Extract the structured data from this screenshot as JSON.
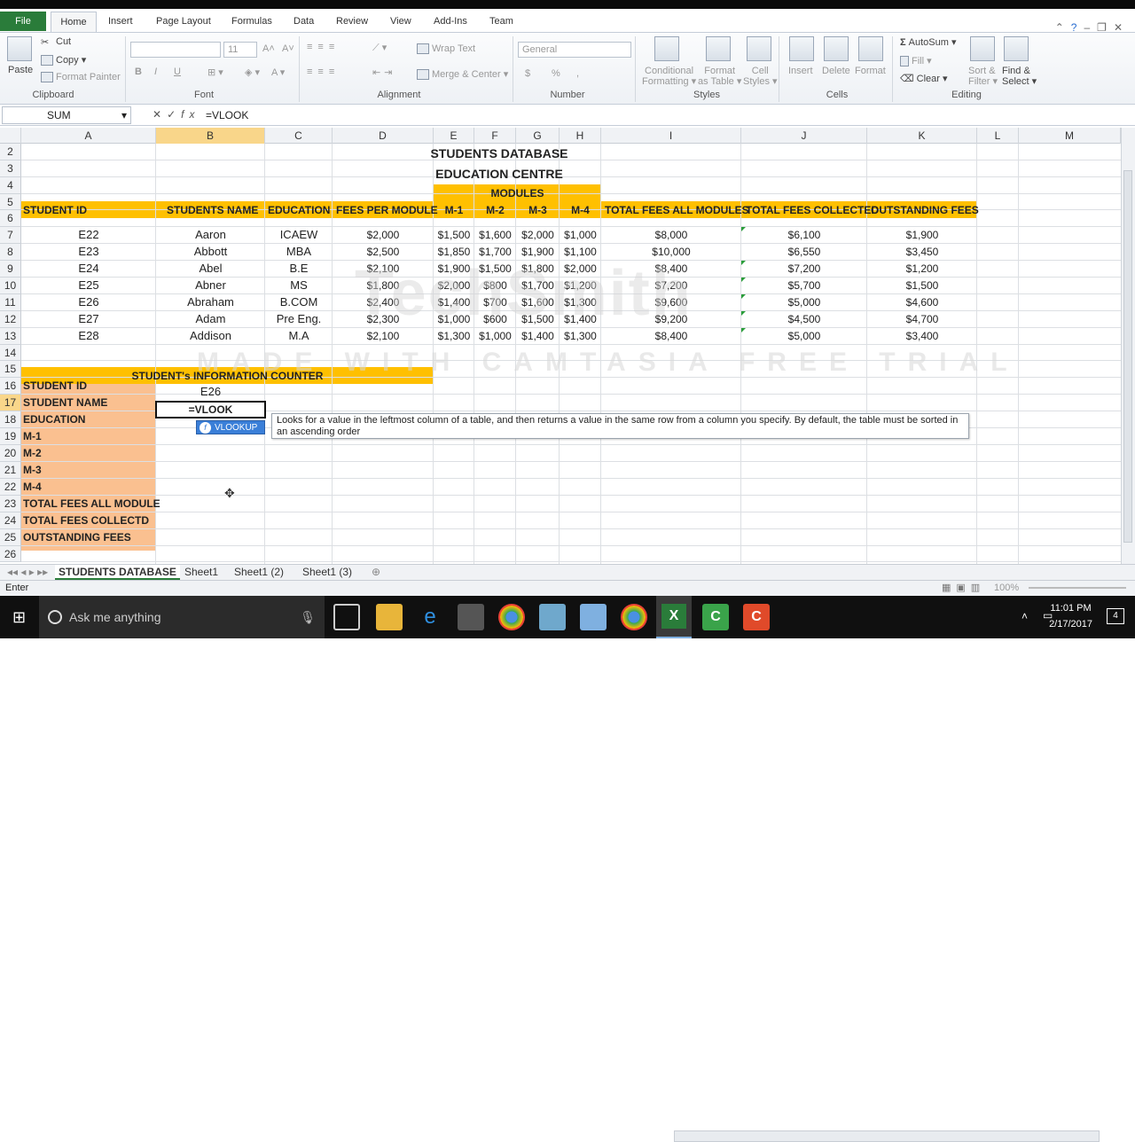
{
  "ribbon_tabs": [
    "File",
    "Home",
    "Insert",
    "Page Layout",
    "Formulas",
    "Data",
    "Review",
    "View",
    "Add-Ins",
    "Team"
  ],
  "clipboard": {
    "paste": "Paste",
    "cut": "Cut",
    "copy": "Copy",
    "format_painter": "Format Painter",
    "label": "Clipboard"
  },
  "font": {
    "name": "",
    "size": "11",
    "label": "Font",
    "bold": "B",
    "italic": "I",
    "underline": "U"
  },
  "alignment": {
    "wrap_text": "Wrap Text",
    "merge_center": "Merge & Center",
    "label": "Alignment"
  },
  "number": {
    "format": "General",
    "label": "Number",
    "currency": "$",
    "percent": "%",
    "comma": ","
  },
  "styles": {
    "conditional": "Conditional",
    "formatting": "Formatting",
    "format": "Format",
    "as_table": "as Table",
    "cell": "Cell",
    "cell_styles": "Styles",
    "label": "Styles"
  },
  "cells": {
    "insert": "Insert",
    "delete": "Delete",
    "format": "Format",
    "label": "Cells"
  },
  "editing": {
    "autosum": "AutoSum",
    "fill": "Fill",
    "clear": "Clear",
    "sort": "Sort &",
    "filter": "Filter",
    "find": "Find &",
    "select": "Select",
    "label": "Editing"
  },
  "formula_bar": {
    "name_box": "SUM",
    "formula": "=VLOOK"
  },
  "columns": [
    "A",
    "B",
    "C",
    "D",
    "E",
    "F",
    "G",
    "H",
    "I",
    "J",
    "K",
    "L",
    "M"
  ],
  "rows": [
    "2",
    "3",
    "4",
    "5",
    "6",
    "7",
    "8",
    "9",
    "10",
    "11",
    "12",
    "13",
    "14",
    "15",
    "16",
    "17",
    "18",
    "19",
    "20",
    "21",
    "22",
    "23",
    "24",
    "25",
    "26"
  ],
  "sheet": {
    "title1": "STUDENTS DATABASE",
    "title2": "EDUCATION CENTRE",
    "modules_label": "MODULES",
    "headers": [
      "STUDENT ID",
      "STUDENTS NAME",
      "EDUCATION",
      "FEES PER MODULE",
      "M-1",
      "M-2",
      "M-3",
      "M-4",
      "TOTAL FEES ALL MODULES",
      "TOTAL FEES COLLECTED",
      "OUTSTANDING FEES"
    ],
    "records": [
      [
        "E22",
        "Aaron",
        "ICAEW",
        "$2,000",
        "$1,500",
        "$1,600",
        "$2,000",
        "$1,000",
        "$8,000",
        "$6,100",
        "$1,900"
      ],
      [
        "E23",
        "Abbott",
        "MBA",
        "$2,500",
        "$1,850",
        "$1,700",
        "$1,900",
        "$1,100",
        "$10,000",
        "$6,550",
        "$3,450"
      ],
      [
        "E24",
        "Abel",
        "B.E",
        "$2,100",
        "$1,900",
        "$1,500",
        "$1,800",
        "$2,000",
        "$8,400",
        "$7,200",
        "$1,200"
      ],
      [
        "E25",
        "Abner",
        "MS",
        "$1,800",
        "$2,000",
        "$800",
        "$1,700",
        "$1,200",
        "$7,200",
        "$5,700",
        "$1,500"
      ],
      [
        "E26",
        "Abraham",
        "B.COM",
        "$2,400",
        "$1,400",
        "$700",
        "$1,600",
        "$1,300",
        "$9,600",
        "$5,000",
        "$4,600"
      ],
      [
        "E27",
        "Adam",
        "Pre Eng.",
        "$2,300",
        "$1,000",
        "$600",
        "$1,500",
        "$1,400",
        "$9,200",
        "$4,500",
        "$4,700"
      ],
      [
        "E28",
        "Addison",
        "M.A",
        "$2,100",
        "$1,300",
        "$1,000",
        "$1,400",
        "$1,300",
        "$8,400",
        "$5,000",
        "$3,400"
      ]
    ],
    "counter_title": "STUDENT's INFORMATION COUNTER",
    "counter_labels": [
      "STUDENT ID",
      "STUDENT NAME",
      "EDUCATION",
      "M-1",
      "M-2",
      "M-3",
      "M-4",
      "TOTAL FEES ALL MODULE",
      "TOTAL FEES COLLECTD",
      "OUTSTANDING FEES"
    ],
    "counter_student_id": "E26",
    "active_cell_text": "=VLOOK"
  },
  "autocomplete": {
    "item": "VLOOKUP",
    "icon": "fx-function-icon"
  },
  "tooltip": "Looks for a value in the leftmost column of a table, and then returns a value in the same row from a column you specify. By default, the table must be sorted in an ascending order",
  "watermark": {
    "line1": "TechSmith",
    "line2": "MADE WITH CAMTASIA FREE TRIAL"
  },
  "sheet_tabs": [
    "STUDENTS DATABASE",
    "Sheet1",
    "Sheet1 (2)",
    "Sheet1 (3)"
  ],
  "status": {
    "mode": "Enter",
    "zoom": "100%"
  },
  "taskbar": {
    "search_placeholder": "Ask me anything",
    "time": "11:01 PM",
    "date": "2/17/2017",
    "notifications": "4"
  },
  "colors": {
    "header_fill": "#ffc000",
    "counter_fill": "#fac090",
    "excel_green": "#2a7c3a",
    "selection": "#f9d68a"
  }
}
